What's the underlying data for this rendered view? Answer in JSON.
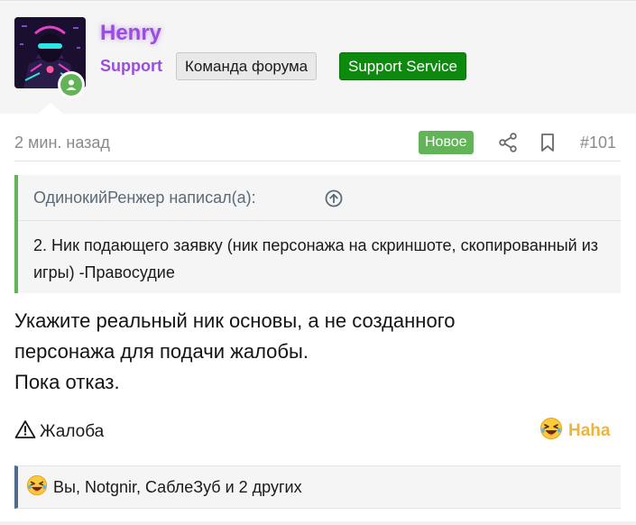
{
  "user": {
    "name": "Henry",
    "role": "Support",
    "banners": [
      "Команда форума",
      "Support Service"
    ]
  },
  "meta": {
    "time": "2 мин. назад",
    "new_label": "Новое",
    "post_number": "#101"
  },
  "quote": {
    "author_line": "ОдинокийРенжер написал(а):",
    "text": "2. Ник подающего заявку (ник персонажа на скриншоте, скопированный из игры) -Правосудие"
  },
  "message": {
    "lines": [
      "Укажите реальный ник основы, а не созданного",
      "персонажа для подачи жалобы.",
      "Пока отказ."
    ]
  },
  "actions": {
    "report_label": "Жалоба",
    "reaction_label": "Haha"
  },
  "reactions": {
    "summary": "Вы, Notgnir, СаблеЗуб и 2 других"
  },
  "colors": {
    "username": "#9b4de0",
    "new_badge": "#63b359",
    "support_banner": "#0d8a0d",
    "haha": "#f0b43c",
    "quote_border": "#63b359",
    "reaction_border": "#4f6b8a"
  },
  "icons": {
    "online": "user-online-icon",
    "share": "share-icon",
    "bookmark": "bookmark-icon",
    "quote_jump": "arrow-up-circle-icon",
    "report": "warning-triangle-icon",
    "haha": "laughing-emoji-icon"
  }
}
